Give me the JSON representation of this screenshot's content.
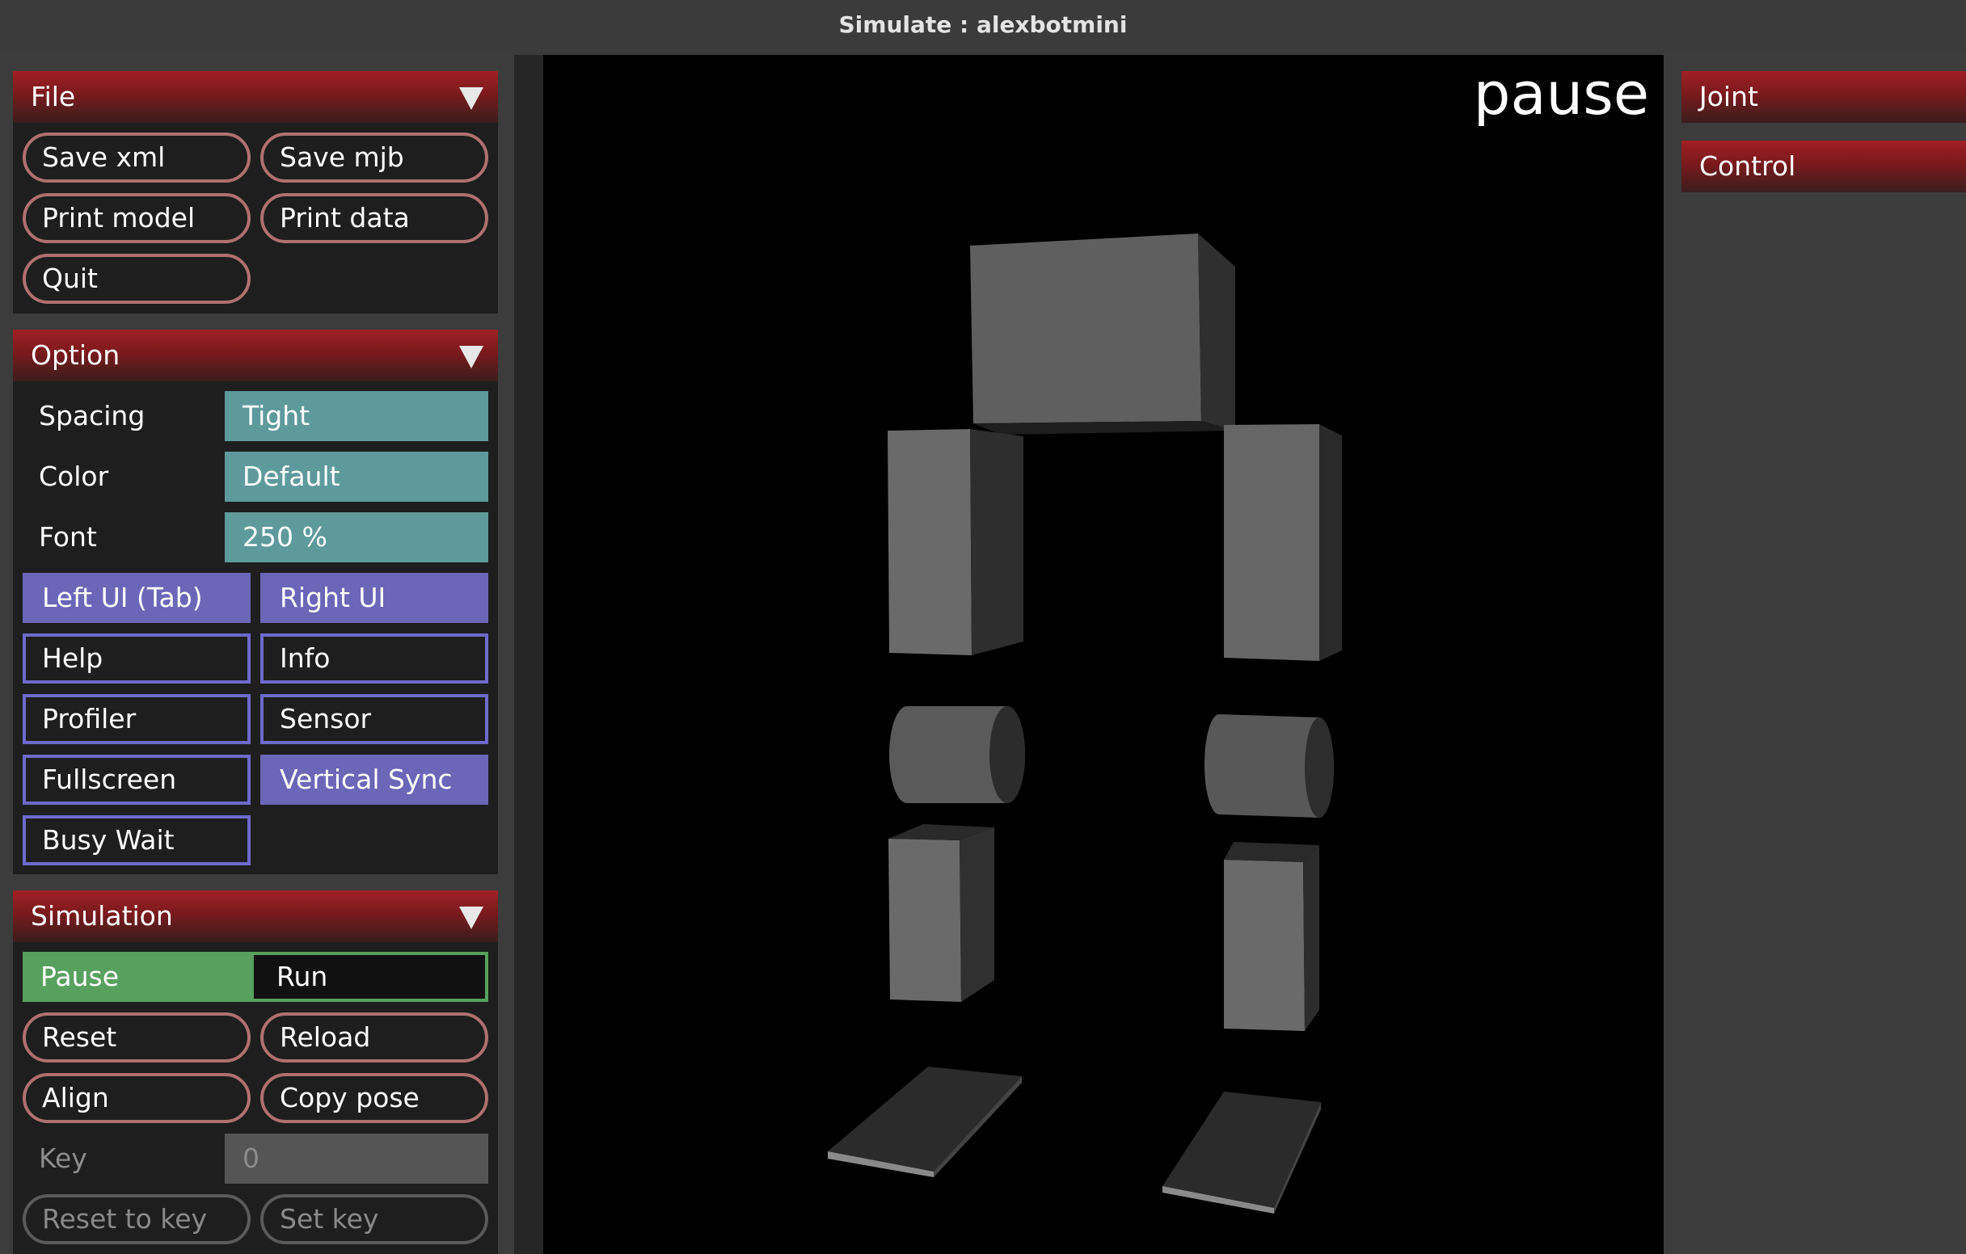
{
  "window": {
    "title": "Simulate : alexbotmini"
  },
  "file": {
    "header": "File",
    "save_xml": "Save xml",
    "save_mjb": "Save mjb",
    "print_model": "Print model",
    "print_data": "Print data",
    "quit": "Quit"
  },
  "option": {
    "header": "Option",
    "spacing_label": "Spacing",
    "spacing_value": "Tight",
    "color_label": "Color",
    "color_value": "Default",
    "font_label": "Font",
    "font_value": "250 %",
    "left_ui": "Left UI (Tab)",
    "right_ui": "Right UI",
    "help": "Help",
    "info": "Info",
    "profiler": "Profiler",
    "sensor": "Sensor",
    "fullscreen": "Fullscreen",
    "vertical_sync": "Vertical Sync",
    "busy_wait": "Busy Wait"
  },
  "simulation": {
    "header": "Simulation",
    "pause": "Pause",
    "run": "Run",
    "reset": "Reset",
    "reload": "Reload",
    "align": "Align",
    "copy_pose": "Copy pose",
    "key_label": "Key",
    "key_value": "0",
    "reset_to_key": "Reset to key",
    "set_key": "Set key"
  },
  "viewport": {
    "status": "pause"
  },
  "right_panel": {
    "joint": "Joint",
    "control": "Control"
  },
  "colors": {
    "header_red": "#a11f24",
    "select_teal": "#5e9a9b",
    "toggle_purple": "#6b66b8",
    "radio_green": "#58a05e",
    "button_border": "#b07070"
  }
}
